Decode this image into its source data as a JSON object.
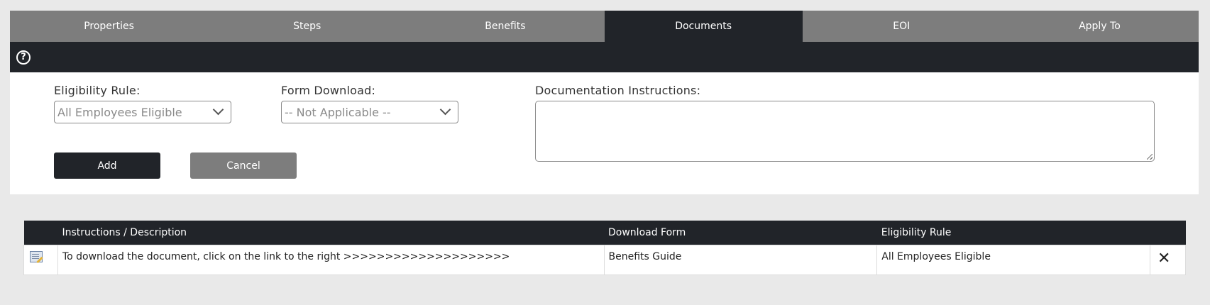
{
  "tabs": [
    {
      "label": "Properties"
    },
    {
      "label": "Steps"
    },
    {
      "label": "Benefits"
    },
    {
      "label": "Documents"
    },
    {
      "label": "EOI"
    },
    {
      "label": "Apply To"
    }
  ],
  "active_tab": "Documents",
  "help": {
    "icon": "help-circle-icon",
    "glyph": "?"
  },
  "form": {
    "eligibility_label": "Eligibility Rule:",
    "eligibility_value": "All Employees Eligible",
    "form_download_label": "Form Download:",
    "form_download_value": "-- Not Applicable --",
    "instructions_label": "Documentation Instructions:",
    "instructions_value": "",
    "add_label": "Add",
    "cancel_label": "Cancel"
  },
  "table": {
    "headers": [
      "",
      "Instructions / Description",
      "Download Form",
      "Eligibility Rule",
      ""
    ],
    "rows": [
      {
        "edit_icon": "edit-document-icon",
        "description": "To download the document, click on the link to the right >>>>>>>>>>>>>>>>>>>>",
        "download_form": "Benefits Guide",
        "eligibility_rule": "All Employees Eligible",
        "delete_icon": "delete-x-icon",
        "delete_glyph": "✕"
      }
    ]
  },
  "colors": {
    "dark": "#212429",
    "gray": "#7d7d7d",
    "background": "#e9e9e9"
  }
}
